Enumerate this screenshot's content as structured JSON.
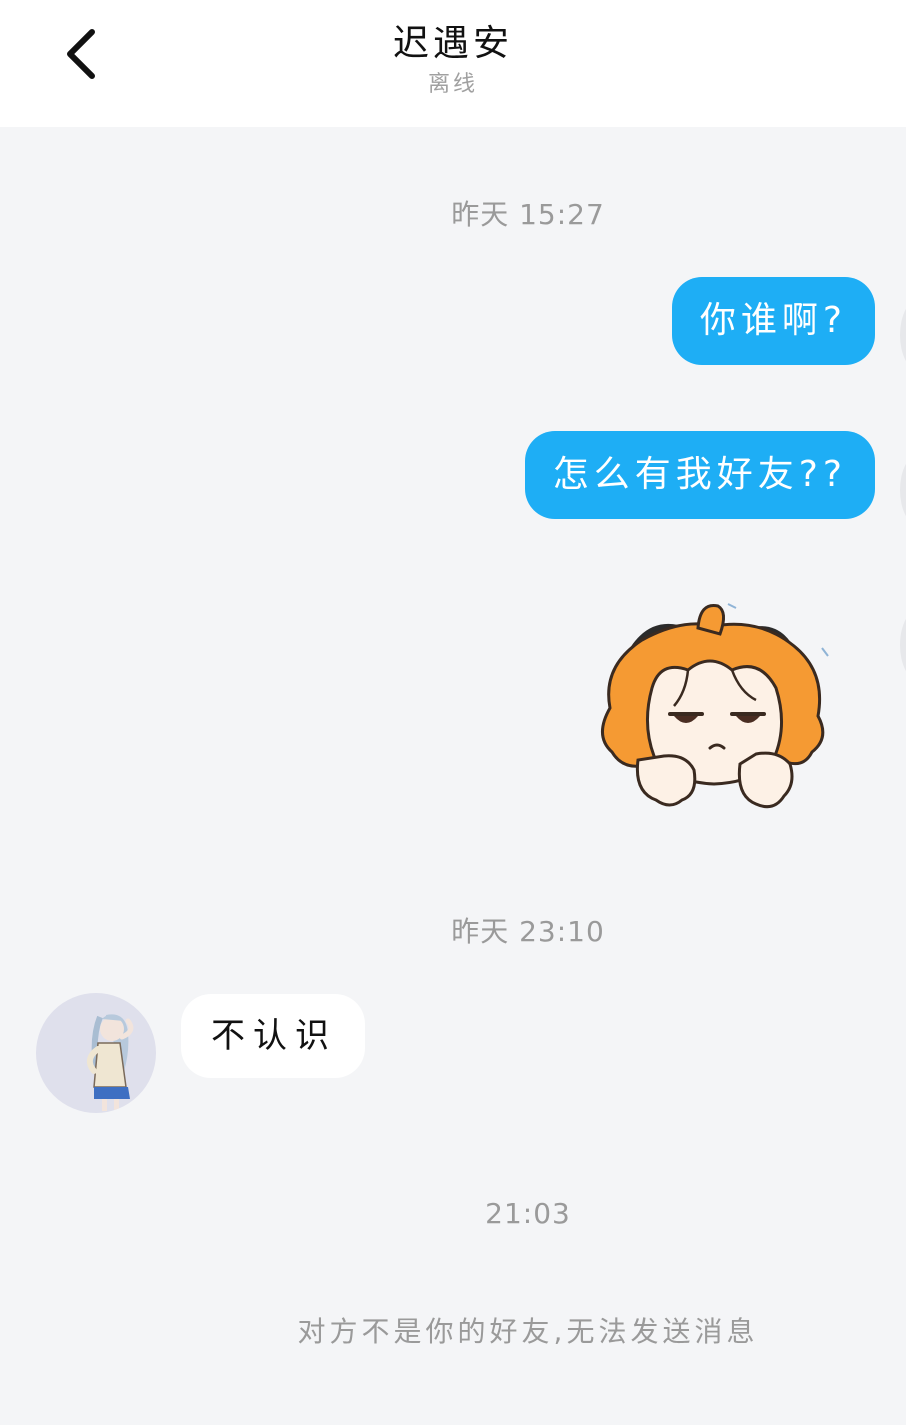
{
  "header": {
    "title": "迟遇安",
    "status": "离线",
    "back_icon": "chevron-left-icon"
  },
  "messages": {
    "time_1": "昨天 15:27",
    "out_1": "你谁啊?",
    "out_2": "怎么有我好友??",
    "sticker": "annoyed-girl-sticker",
    "time_2": "昨天 23:10",
    "in_1": "不认识",
    "time_3": "21:03"
  },
  "notice": "对方不是你的好友,无法发送消息",
  "colors": {
    "outgoing_bubble": "#1eaef5",
    "incoming_bubble": "#ffffff",
    "background": "#f4f5f7",
    "muted_text": "#9a9a9a"
  }
}
